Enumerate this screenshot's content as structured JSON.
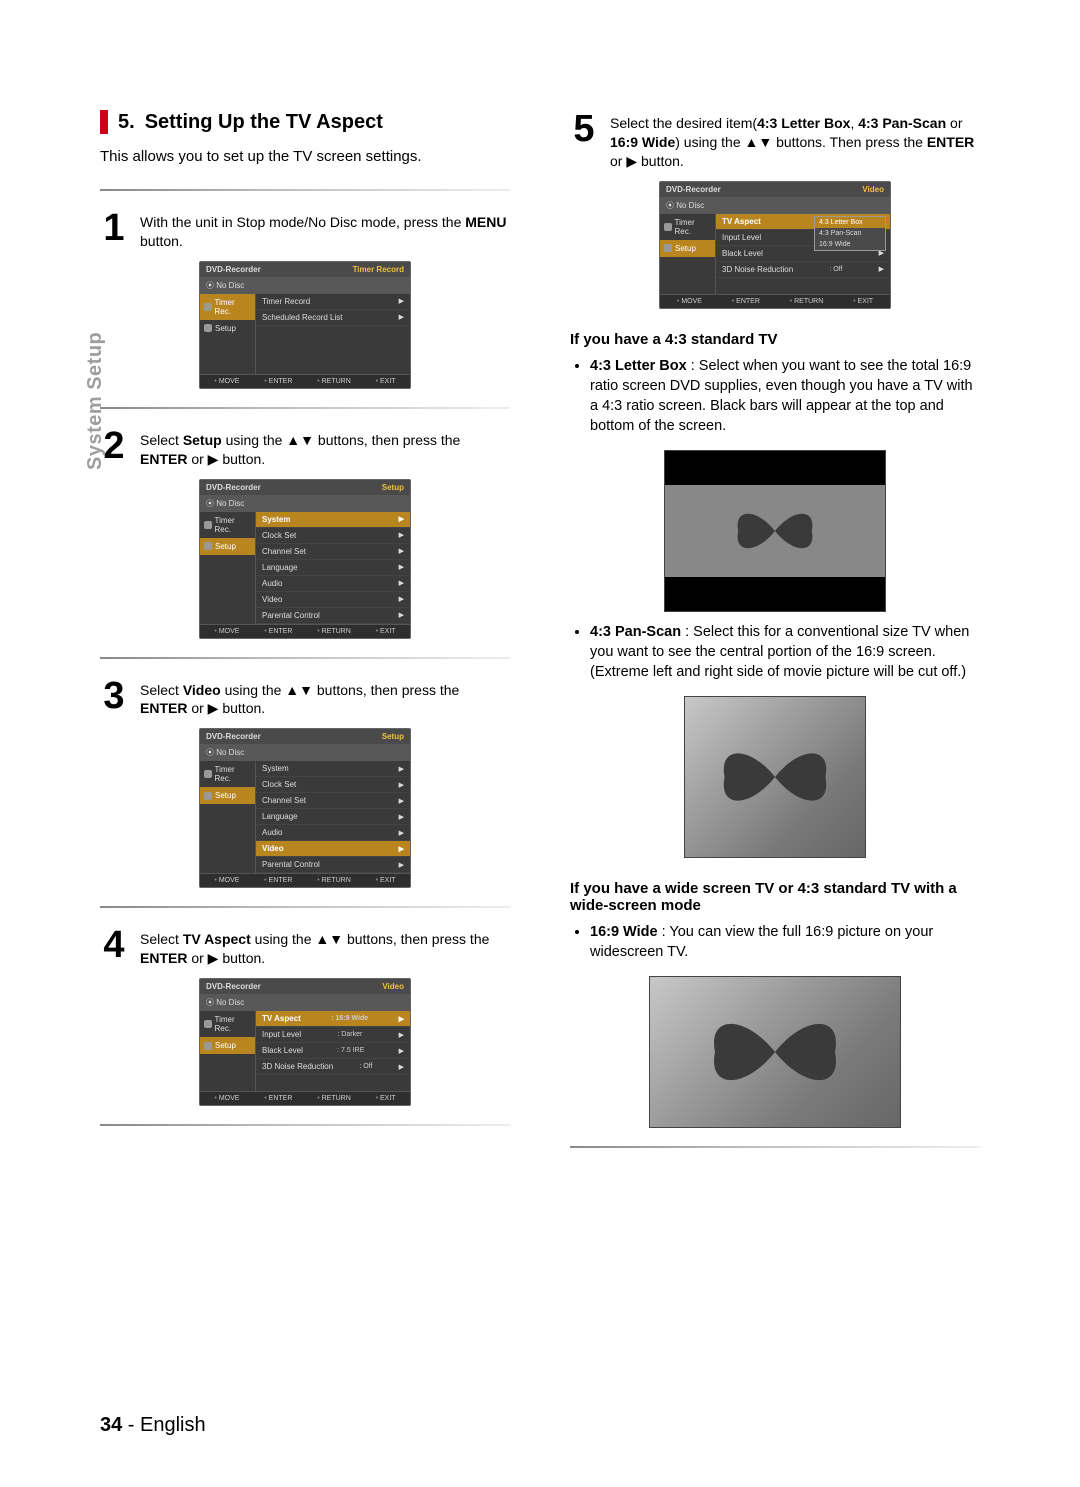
{
  "page": {
    "number": "34",
    "language": "English",
    "sideTab": "System Setup"
  },
  "section": {
    "num": "5.",
    "title": "Setting Up the TV Aspect",
    "intro": "This allows you to set up the TV screen settings."
  },
  "steps": {
    "s1": {
      "num": "1",
      "pre": "With the unit in Stop mode/No Disc mode, press the ",
      "b": "MENU",
      "post": " button."
    },
    "s2": {
      "num": "2",
      "pre": "Select ",
      "b1": "Setup",
      "mid": " using the ▲▼ buttons, then press the ",
      "b2": "ENTER",
      "post": " or ▶ button."
    },
    "s3": {
      "num": "3",
      "pre": "Select ",
      "b1": "Video",
      "mid": " using the ▲▼ buttons, then press the ",
      "b2": "ENTER",
      "post": " or ▶ button."
    },
    "s4": {
      "num": "4",
      "pre": "Select ",
      "b1": "TV Aspect",
      "mid": " using the ▲▼ buttons, then press the ",
      "b2": "ENTER",
      "post": " or ▶ button."
    },
    "s5": {
      "num": "5",
      "a": "Select the desired item(",
      "o1": "4:3 Letter Box",
      "c1": ", ",
      "o2": "4:3 Pan-Scan",
      "c2": " or ",
      "o3": "16:9 Wide",
      "b": ") using the ▲▼ buttons. Then press the ",
      "enter": "ENTER",
      "post": " or ▶ button."
    }
  },
  "osd": {
    "recorder": "DVD-Recorder",
    "nodisc": "No Disc",
    "timerRec": "Timer Rec.",
    "setup": "Setup",
    "titles": {
      "timerRecord": "Timer Record",
      "setup": "Setup",
      "video": "Video"
    },
    "footer": {
      "move": "MOVE",
      "enter": "ENTER",
      "return": "RETURN",
      "exit": "EXIT"
    },
    "menu1": {
      "r1": "Timer Record",
      "r2": "Scheduled Record List"
    },
    "menu2": {
      "r1": "System",
      "r2": "Clock Set",
      "r3": "Channel Set",
      "r4": "Language",
      "r5": "Audio",
      "r6": "Video",
      "r7": "Parental Control"
    },
    "menu4": {
      "r1": "TV Aspect",
      "v1": ": 16:9 Wide",
      "r2": "Input Level",
      "v2": ": Darker",
      "r3": "Black Level",
      "v3": ": 7.5 IRE",
      "r4": "3D Noise Reduction",
      "v4": ": Off"
    },
    "menu5": {
      "r1": "TV Aspect",
      "r2": "Input Level",
      "r3": "Black Level",
      "r4": "3D Noise Reduction",
      "v4": ": Off",
      "sub1": "4:3 Letter Box",
      "sub2": "4:3 Pan-Scan",
      "sub3": "16:9 Wide"
    }
  },
  "right": {
    "h1": "If you have a 4:3 standard TV",
    "li1b": "4:3 Letter Box",
    "li1": " : Select when you want to see the total 16:9 ratio screen DVD supplies, even though you have a TV with a 4:3 ratio screen. Black bars will appear at the top and bottom of the screen.",
    "li2b": "4:3 Pan-Scan",
    "li2": " : Select this for a conventional size TV when you want to see the central portion of the 16:9 screen. (Extreme left and right side of movie picture will be cut off.)",
    "h2": "If you have a wide screen TV or 4:3 standard TV with a wide-screen mode",
    "li3b": "16:9 Wide",
    "li3": " : You can view the full 16:9 picture on your widescreen TV."
  }
}
